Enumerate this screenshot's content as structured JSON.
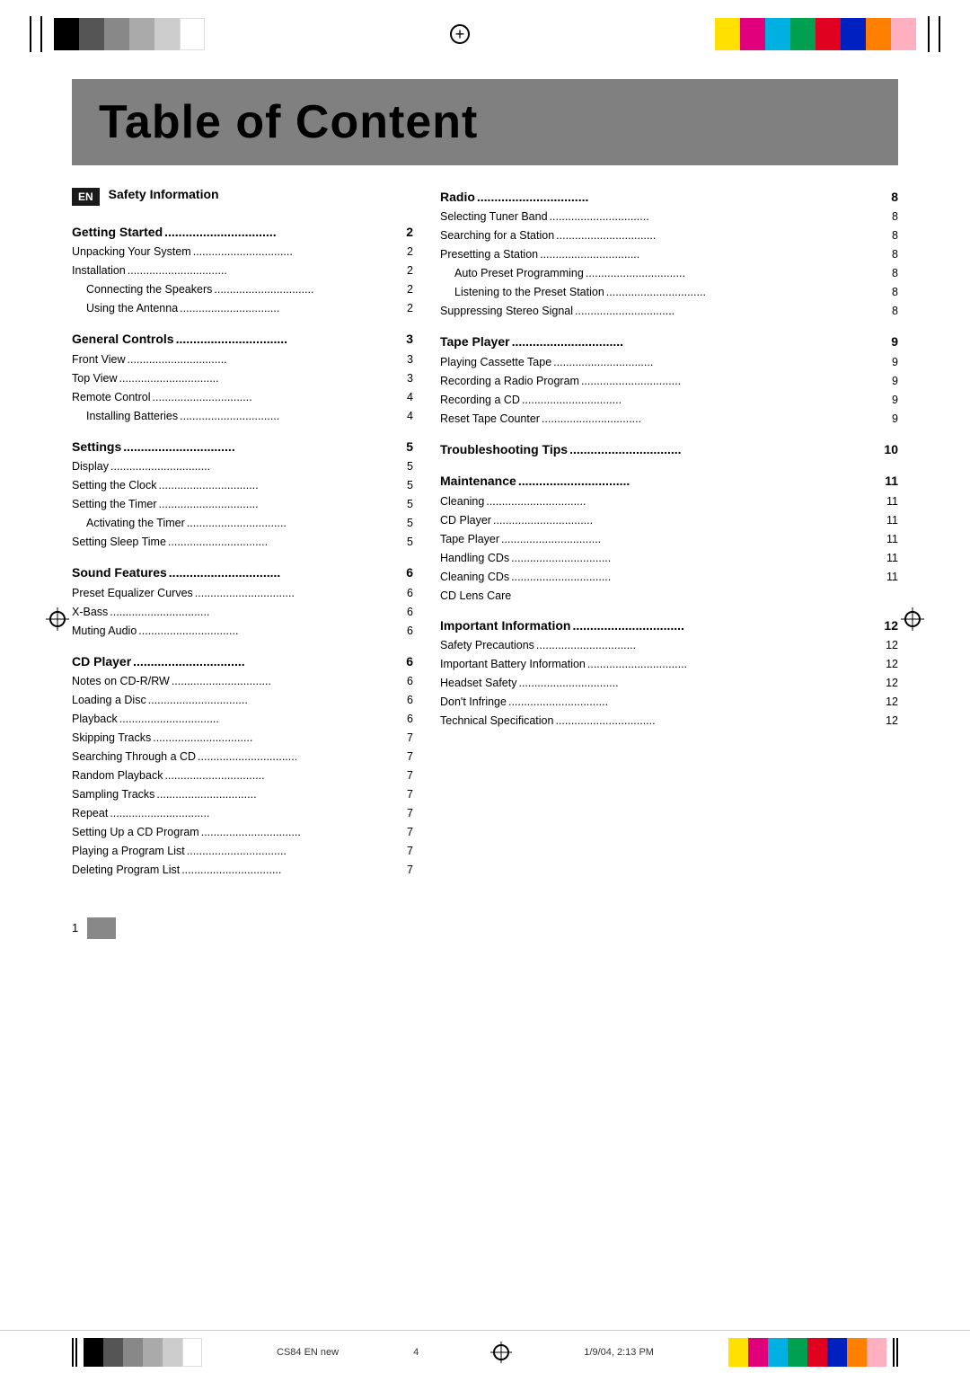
{
  "header": {
    "title": "Table of Content"
  },
  "en_label": "EN",
  "safety_info": "Safety Information",
  "left_column": {
    "sections": [
      {
        "title": "Getting Started",
        "page": "2",
        "entries": [
          {
            "text": "Unpacking Your System",
            "dots": true,
            "page": "2",
            "indent": 0
          },
          {
            "text": "Installation",
            "dots": true,
            "page": "2",
            "indent": 0
          },
          {
            "text": "Connecting the Speakers",
            "dots": true,
            "page": "2",
            "indent": 1
          },
          {
            "text": "Using the Antenna",
            "dots": true,
            "page": "2",
            "indent": 1
          }
        ]
      },
      {
        "title": "General Controls",
        "page": "3",
        "entries": [
          {
            "text": "Front View",
            "dots": true,
            "page": "3",
            "indent": 0
          },
          {
            "text": "Top View",
            "dots": true,
            "page": "3",
            "indent": 0
          },
          {
            "text": "Remote Control",
            "dots": true,
            "page": "4",
            "indent": 0
          },
          {
            "text": "Installing Batteries",
            "dots": true,
            "page": "4",
            "indent": 1
          }
        ]
      },
      {
        "title": "Settings",
        "page": "5",
        "entries": [
          {
            "text": "Display",
            "dots": true,
            "page": "5",
            "indent": 0
          },
          {
            "text": "Setting the Clock",
            "dots": true,
            "page": "5",
            "indent": 0
          },
          {
            "text": "Setting the Timer",
            "dots": true,
            "page": "5",
            "indent": 0
          },
          {
            "text": "Activating the Timer",
            "dots": true,
            "page": "5",
            "indent": 1
          },
          {
            "text": "Setting Sleep Time",
            "dots": true,
            "page": "5",
            "indent": 0
          }
        ]
      },
      {
        "title": "Sound Features",
        "page": "6",
        "entries": [
          {
            "text": "Preset Equalizer Curves",
            "dots": true,
            "page": "6",
            "indent": 0
          },
          {
            "text": "X-Bass",
            "dots": true,
            "page": "6",
            "indent": 0
          },
          {
            "text": "Muting Audio",
            "dots": true,
            "page": "6",
            "indent": 0
          }
        ]
      },
      {
        "title": "CD Player",
        "page": "6",
        "entries": [
          {
            "text": "Notes on CD-R/RW",
            "dots": true,
            "page": "6",
            "indent": 0
          },
          {
            "text": "Loading a Disc",
            "dots": true,
            "page": "6",
            "indent": 0
          },
          {
            "text": "Playback",
            "dots": true,
            "page": "6",
            "indent": 0
          },
          {
            "text": "Skipping Tracks",
            "dots": true,
            "page": "7",
            "indent": 0
          },
          {
            "text": "Searching Through a CD",
            "dots": true,
            "page": "7",
            "indent": 0
          },
          {
            "text": "Random Playback",
            "dots": true,
            "page": "7",
            "indent": 0
          },
          {
            "text": "Sampling Tracks",
            "dots": true,
            "page": "7",
            "indent": 0
          },
          {
            "text": "Repeat",
            "dots": true,
            "page": "7",
            "indent": 0
          },
          {
            "text": "Setting Up a CD Program",
            "dots": true,
            "page": "7",
            "indent": 0
          },
          {
            "text": "Playing a Program List",
            "dots": true,
            "page": "7",
            "indent": 0
          },
          {
            "text": "Deleting Program List",
            "dots": true,
            "page": "7",
            "indent": 0
          }
        ]
      }
    ]
  },
  "right_column": {
    "sections": [
      {
        "title": "Radio",
        "page": "8",
        "entries": [
          {
            "text": "Selecting Tuner Band",
            "dots": true,
            "page": "8",
            "indent": 0
          },
          {
            "text": "Searching for a Station",
            "dots": true,
            "page": "8",
            "indent": 0
          },
          {
            "text": "Presetting a Station",
            "dots": true,
            "page": "8",
            "indent": 0
          },
          {
            "text": "Auto Preset Programming",
            "dots": true,
            "page": "8",
            "indent": 1
          },
          {
            "text": "Listening to the Preset Station",
            "dots": true,
            "page": "8",
            "indent": 1
          },
          {
            "text": "Suppressing Stereo Signal",
            "dots": true,
            "page": "8",
            "indent": 0
          }
        ]
      },
      {
        "title": "Tape Player",
        "page": "9",
        "entries": [
          {
            "text": "Playing Cassette Tape",
            "dots": true,
            "page": "9",
            "indent": 0
          },
          {
            "text": "Recording a Radio Program",
            "dots": true,
            "page": "9",
            "indent": 0
          },
          {
            "text": "Recording a CD",
            "dots": true,
            "page": "9",
            "indent": 0
          },
          {
            "text": "Reset Tape Counter",
            "dots": true,
            "page": "9",
            "indent": 0
          }
        ]
      },
      {
        "title": "Troubleshooting Tips",
        "page": "10",
        "entries": []
      },
      {
        "title": "Maintenance",
        "page": "11",
        "entries": [
          {
            "text": "Cleaning",
            "dots": true,
            "page": "11",
            "indent": 0
          },
          {
            "text": "CD Player",
            "dots": true,
            "page": "11",
            "indent": 0
          },
          {
            "text": "Tape Player",
            "dots": true,
            "page": "11",
            "indent": 0
          },
          {
            "text": "Handling CDs",
            "dots": true,
            "page": "11",
            "indent": 0
          },
          {
            "text": "Cleaning CDs",
            "dots": true,
            "page": "11",
            "indent": 0
          },
          {
            "text": "CD Lens Care",
            "dots": false,
            "page": "",
            "indent": 0
          }
        ]
      },
      {
        "title": "Important Information",
        "page": "12",
        "entries": [
          {
            "text": "Safety Precautions",
            "dots": true,
            "page": "12",
            "indent": 0
          },
          {
            "text": "Important Battery Information",
            "dots": true,
            "page": "12",
            "indent": 0
          },
          {
            "text": "Headset Safety",
            "dots": true,
            "page": "12",
            "indent": 0
          },
          {
            "text": "Don't Infringe",
            "dots": true,
            "page": "12",
            "indent": 0
          },
          {
            "text": "Technical Specification",
            "dots": true,
            "page": "12",
            "indent": 0
          }
        ]
      }
    ]
  },
  "footer": {
    "page_number": "1",
    "doc_code": "CS84 EN new",
    "print_page": "4",
    "date": "1/9/04, 2:13 PM"
  }
}
